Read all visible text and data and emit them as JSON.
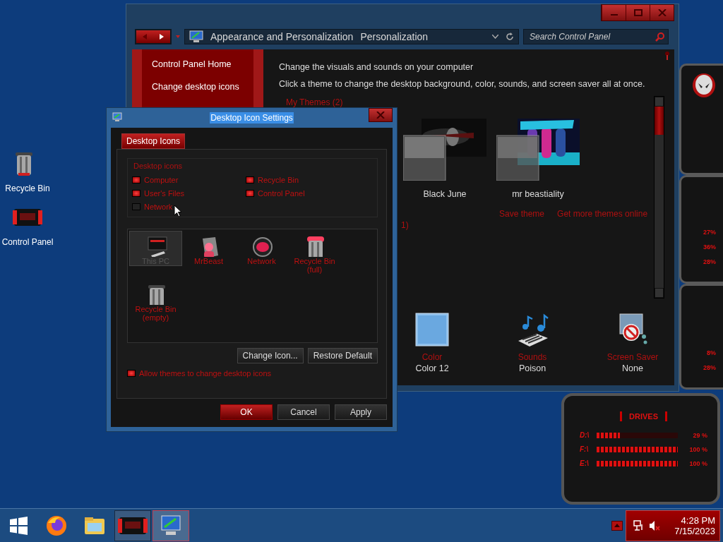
{
  "desktop_icons": [
    {
      "label": "Recycle Bin",
      "kind": "bin"
    },
    {
      "label": "Control Panel",
      "kind": "panel"
    }
  ],
  "control_panel": {
    "breadcrumb": [
      "Appearance and Personalization",
      "Personalization"
    ],
    "search": {
      "placeholder": "Search Control Panel"
    },
    "sidebar": {
      "items": [
        "Control Panel Home",
        "Change desktop icons"
      ]
    },
    "heading": "Change the visuals and sounds on your computer",
    "intro": "Click a theme to change the desktop background, color, sounds, and screen saver all at once.",
    "section_title": "My Themes (2)",
    "themes": [
      {
        "name": "Black June",
        "kind": "dark"
      },
      {
        "name": "mr beastiality",
        "kind": "neon"
      }
    ],
    "links": [
      "Save theme",
      "Get more themes online"
    ],
    "fragment": "1)",
    "settings": [
      {
        "label": "Color",
        "value": "Color 12",
        "kind": "color"
      },
      {
        "label": "Sounds",
        "value": "Poison",
        "kind": "sounds"
      },
      {
        "label": "Screen Saver",
        "value": "None",
        "kind": "screensaver"
      }
    ]
  },
  "dialog": {
    "title": "Desktop Icon Settings",
    "title_highlighted": true,
    "tabs": [
      {
        "label": "Desktop Icons",
        "selected": true
      }
    ],
    "group_label": "Desktop icons",
    "checkboxes": [
      {
        "label": "Computer",
        "checked": true
      },
      {
        "label": "Recycle Bin",
        "checked": true
      },
      {
        "label": "User's Files",
        "checked": true
      },
      {
        "label": "Control Panel",
        "checked": true
      },
      {
        "label": "Network",
        "checked": false
      }
    ],
    "icons": [
      {
        "label": "This PC",
        "kind": "pc",
        "selected": true
      },
      {
        "label": "MrBeast",
        "kind": "user",
        "selected": false
      },
      {
        "label": "Network",
        "kind": "network",
        "selected": false
      },
      {
        "label": "Recycle Bin (full)",
        "kind": "bin_full",
        "selected": false
      },
      {
        "label": "Recycle Bin (empty)",
        "kind": "bin",
        "selected": false
      }
    ],
    "buttons": [
      "Change Icon...",
      "Restore Default"
    ],
    "allow_themes": {
      "label": "Allow themes to change desktop icons",
      "checked": true
    },
    "footer_buttons": [
      {
        "label": "OK",
        "kind": "default"
      },
      {
        "label": "Cancel",
        "kind": "normal"
      },
      {
        "label": "Apply",
        "kind": "normal"
      }
    ]
  },
  "gadgets": {
    "panels": [
      {
        "kind": "logo"
      },
      {
        "kind": "meter",
        "readings": [
          "27%",
          "36%",
          "28%"
        ]
      },
      {
        "kind": "meter",
        "readings": [
          "8%",
          "28%"
        ]
      }
    ],
    "drives": {
      "title": "DRIVES",
      "items": [
        {
          "name": "D:\\",
          "level": 0.29,
          "reading": "29 %"
        },
        {
          "name": "F:\\",
          "level": 1,
          "reading": "100 %"
        },
        {
          "name": "E:\\",
          "level": 1,
          "reading": "100 %"
        }
      ]
    }
  },
  "taskbar": {
    "apps": [
      {
        "kind": "start",
        "running": false,
        "selected": false
      },
      {
        "kind": "firefox",
        "running": false,
        "selected": false
      },
      {
        "kind": "folder",
        "running": false,
        "selected": false
      },
      {
        "kind": "panel",
        "running": true,
        "selected": false
      },
      {
        "kind": "display",
        "running": true,
        "selected": true
      }
    ],
    "clock": {
      "time": "4:28 PM",
      "date": "7/15/2023"
    }
  }
}
